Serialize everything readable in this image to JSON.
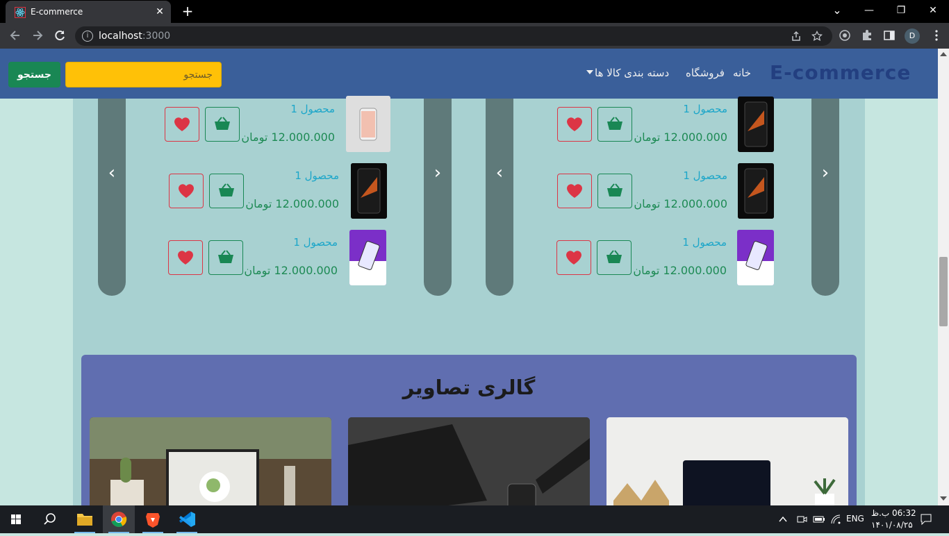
{
  "browser": {
    "tab_title": "E-commerce",
    "tab_close": "✕",
    "new_tab": "+",
    "url_host": "localhost",
    "url_port": ":3000",
    "profile_initial": "D",
    "win_min": "—",
    "win_restore": "❐",
    "win_close": "✕",
    "tab_menu": "⌄"
  },
  "header": {
    "brand": "E-commerce",
    "nav": {
      "home": "خانه",
      "shop": "فروشگاه",
      "categories": "دسته بندی کالا ها"
    },
    "search_placeholder": "جستجو",
    "search_button": "جستجو"
  },
  "products": {
    "left": [
      {
        "title": "محصول 1",
        "price": "12.000.000 تومان",
        "image": "phone-white"
      },
      {
        "title": "محصول 1",
        "price": "12.000.000 تومان",
        "image": "phone-dark"
      },
      {
        "title": "محصول 1",
        "price": "12.000.000 تومان",
        "image": "phone-purple"
      }
    ],
    "right": [
      {
        "title": "محصول 1",
        "price": "12.000.000 تومان",
        "image": "phone-dark"
      },
      {
        "title": "محصول 1",
        "price": "12.000.000 تومان",
        "image": "phone-dark"
      },
      {
        "title": "محصول 1",
        "price": "12.000.000 تومان",
        "image": "phone-purple"
      }
    ]
  },
  "gallery": {
    "title": "گالری تصاویر"
  },
  "taskbar": {
    "lang": "ENG",
    "time": "06:32 ب.ظ",
    "date": "۱۴۰۱/۰۸/۲۵"
  },
  "colors": {
    "header_bg": "#3a5f9a",
    "search_bg": "#ffc107",
    "search_btn": "#198754",
    "price": "#1d8a54",
    "title": "#1ca6c9",
    "heart": "#dc3545",
    "gallery_bg": "#606eb0"
  }
}
